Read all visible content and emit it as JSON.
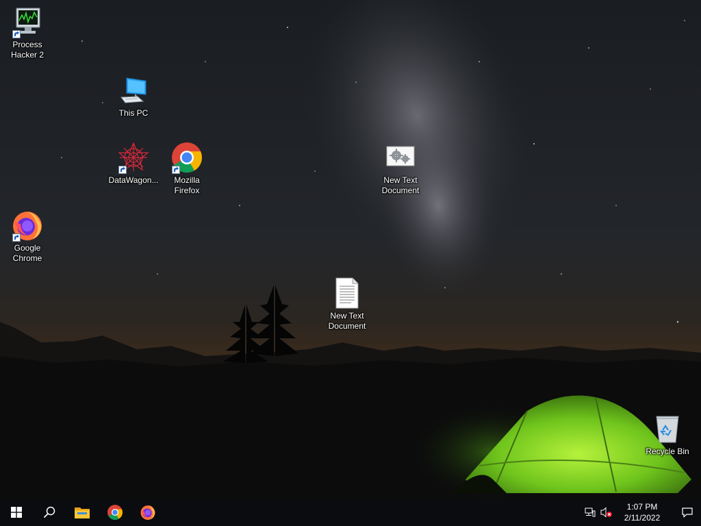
{
  "desktop": {
    "icons": [
      {
        "id": "process-hacker",
        "label": "Process\nHacker 2",
        "shortcut": true,
        "icon": "monitor-chart-icon"
      },
      {
        "id": "this-pc",
        "label": "This PC",
        "shortcut": false,
        "icon": "computer-icon"
      },
      {
        "id": "datawagon",
        "label": "DataWagon...",
        "shortcut": true,
        "icon": "datawagon-icon"
      },
      {
        "id": "mozilla-firefox",
        "label": "Mozilla\nFirefox",
        "shortcut": true,
        "icon": "chrome-icon"
      },
      {
        "id": "new-text-doc-1",
        "label": "New Text\nDocument",
        "shortcut": false,
        "icon": "gears-file-icon"
      },
      {
        "id": "google-chrome",
        "label": "Google\nChrome",
        "shortcut": true,
        "icon": "firefox-icon"
      },
      {
        "id": "new-text-doc-2",
        "label": "New Text\nDocument",
        "shortcut": false,
        "icon": "text-file-icon"
      },
      {
        "id": "recycle-bin",
        "label": "Recycle Bin",
        "shortcut": false,
        "icon": "recycle-bin-icon"
      }
    ]
  },
  "taskbar": {
    "pinned": [
      "start-icon",
      "search-icon",
      "file-explorer-icon",
      "chrome-icon",
      "firefox-icon"
    ],
    "tray": {
      "network_icon": "network-icon",
      "volume_icon": "volume-muted-icon",
      "time": "1:07 PM",
      "date": "2/11/2022",
      "notification_icon": "notification-icon"
    }
  },
  "colors": {
    "taskbar": "#0b0c0f",
    "tent": "#7fd12a",
    "sunset": "#e0691a"
  }
}
